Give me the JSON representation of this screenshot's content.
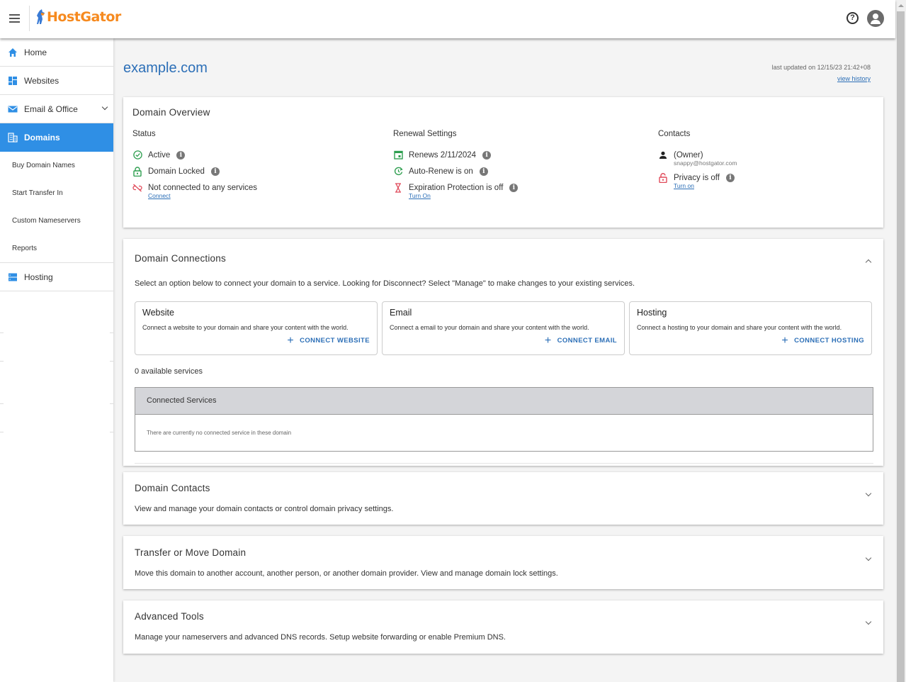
{
  "header": {
    "logo_text": "HostGator",
    "help_label": "?",
    "brand_color": "#f68a1f"
  },
  "sidebar": {
    "items": [
      {
        "label": "Home",
        "icon": "home-icon"
      },
      {
        "label": "Websites",
        "icon": "websites-icon"
      },
      {
        "label": "Email & Office",
        "icon": "email-icon"
      },
      {
        "label": "Domains",
        "icon": "domains-icon",
        "active": true
      },
      {
        "label": "Hosting",
        "icon": "hosting-icon"
      }
    ],
    "sub_items": [
      "Buy Domain Names",
      "Start Transfer In",
      "Custom Nameservers",
      "Reports"
    ],
    "active_color": "#2f8fe5"
  },
  "page": {
    "domain": "example.com",
    "last_updated": "last updated on 12/15/23 21:42+08",
    "view_history": "view history"
  },
  "overview": {
    "title": "Domain Overview",
    "status": {
      "heading": "Status",
      "active": "Active",
      "locked": "Domain Locked",
      "not_connected": "Not connected to any services",
      "connect_link": "Connect"
    },
    "renewal": {
      "heading": "Renewal Settings",
      "renews": "Renews 2/11/2024",
      "auto_renew": "Auto-Renew is on",
      "expiration": "Expiration Protection is off",
      "turn_on_link": "Turn On"
    },
    "contacts": {
      "heading": "Contacts",
      "owner": "(Owner)",
      "email": "snappy@hostgator.com",
      "privacy": "Privacy is off",
      "turn_on_link": "Turn on"
    }
  },
  "connections": {
    "title": "Domain Connections",
    "description": "Select an option below to connect your domain to a service. Looking for Disconnect? Select \"Manage\" to make changes to your existing services.",
    "services": [
      {
        "title": "Website",
        "desc": "Connect a website to your domain and share your content with the world.",
        "button": "CONNECT WEBSITE"
      },
      {
        "title": "Email",
        "desc": "Connect a email to your domain and share your content with the world.",
        "button": "CONNECT EMAIL"
      },
      {
        "title": "Hosting",
        "desc": "Connect a hosting to your domain and share your content with the world.",
        "button": "CONNECT HOSTING"
      }
    ],
    "available": "0 available services",
    "connected_header": "Connected Services",
    "connected_empty": "There are currently no connected service in these domain"
  },
  "sections": [
    {
      "title": "Domain Contacts",
      "desc": "View and manage your domain contacts or control domain privacy settings."
    },
    {
      "title": "Transfer or Move Domain",
      "desc": "Move this domain to another account, another person, or another domain provider. View and manage domain lock settings."
    },
    {
      "title": "Advanced Tools",
      "desc": "Manage your nameservers and advanced DNS records. Setup website forwarding or enable Premium DNS."
    }
  ]
}
